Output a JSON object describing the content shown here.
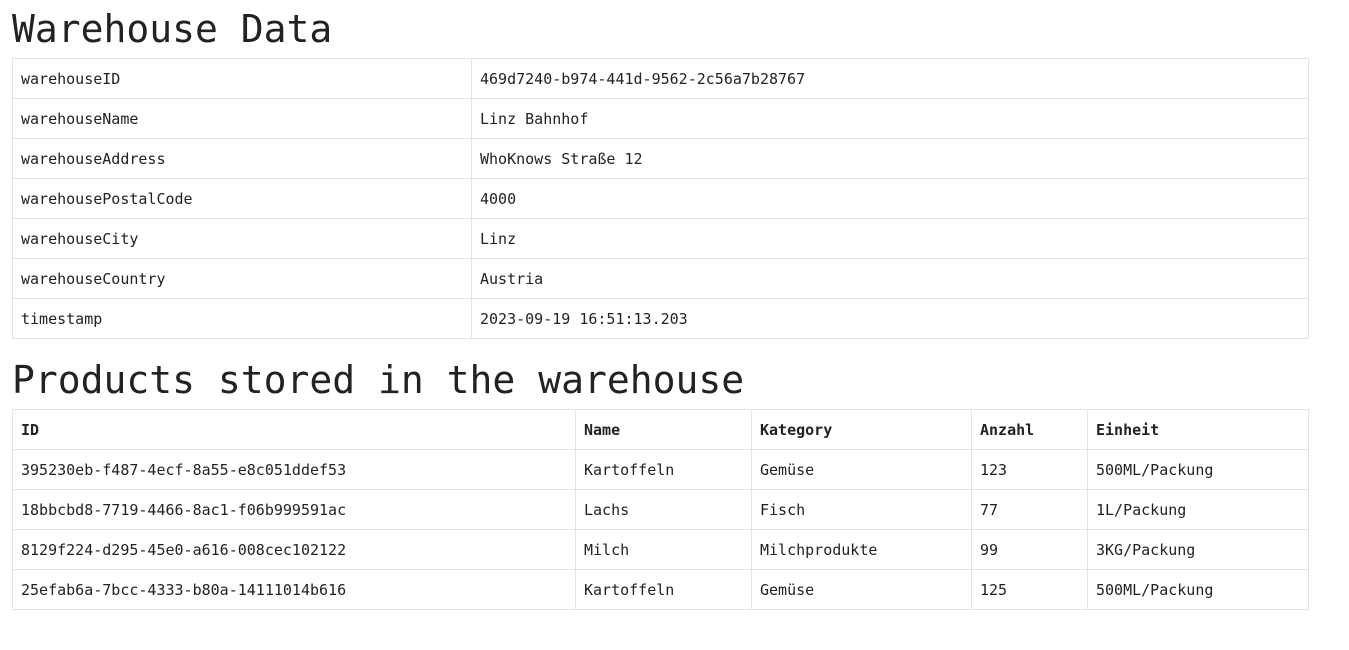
{
  "warehouse": {
    "title": "Warehouse Data",
    "rows": [
      {
        "key": "warehouseID",
        "value": "469d7240-b974-441d-9562-2c56a7b28767"
      },
      {
        "key": "warehouseName",
        "value": "Linz Bahnhof"
      },
      {
        "key": "warehouseAddress",
        "value": "WhoKnows Straße 12"
      },
      {
        "key": "warehousePostalCode",
        "value": "4000"
      },
      {
        "key": "warehouseCity",
        "value": "Linz"
      },
      {
        "key": "warehouseCountry",
        "value": "Austria"
      },
      {
        "key": "timestamp",
        "value": "2023-09-19 16:51:13.203"
      }
    ]
  },
  "products": {
    "title": "Products stored in the warehouse",
    "headers": [
      "ID",
      "Name",
      "Kategory",
      "Anzahl",
      "Einheit"
    ],
    "rows": [
      [
        "395230eb-f487-4ecf-8a55-e8c051ddef53",
        "Kartoffeln",
        "Gemüse",
        "123",
        "500ML/Packung"
      ],
      [
        "18bbcbd8-7719-4466-8ac1-f06b999591ac",
        "Lachs",
        "Fisch",
        "77",
        "1L/Packung"
      ],
      [
        "8129f224-d295-45e0-a616-008cec102122",
        "Milch",
        "Milchprodukte",
        "99",
        "3KG/Packung"
      ],
      [
        "25efab6a-7bcc-4333-b80a-14111014b616",
        "Kartoffeln",
        "Gemüse",
        "125",
        "500ML/Packung"
      ]
    ]
  }
}
